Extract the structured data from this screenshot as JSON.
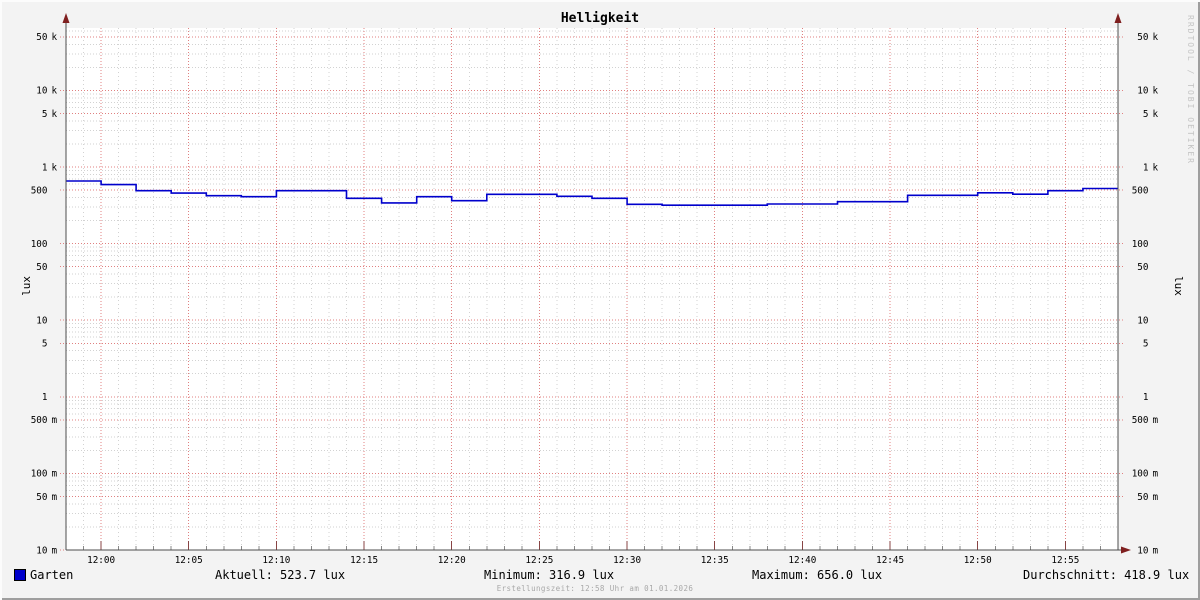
{
  "title": "Helligkeit",
  "watermark": "RRDTOOL / TOBI OETIKER",
  "axes": {
    "left_unit_label": "lux",
    "right_unit_label": "lux"
  },
  "legend": {
    "series_label": "Garten"
  },
  "stats": {
    "aktuell": "Aktuell: 523.7 lux",
    "minimum": "Minimum: 316.9 lux",
    "maximum": "Maximum: 656.0 lux",
    "durchschnitt": "Durchschnitt: 418.9 lux"
  },
  "footer": {
    "creation_text": "Erstellungszeit: 12:58 Uhr am 01.01.2026"
  },
  "chart_data": {
    "type": "line",
    "title": "Helligkeit",
    "xlabel": "",
    "ylabel": "lux",
    "y_scale": "logarithmic",
    "ylim": [
      0.01,
      65000
    ],
    "x_range": [
      "11:58",
      "12:58"
    ],
    "grid": true,
    "legend_position": "bottom-left",
    "colors": {
      "background": "#f3f3f3",
      "canvas": "#ffffff",
      "major_grid": "#e08080",
      "minor_grid": "#d2d2d2",
      "axis": "#4d4d4d",
      "arrow": "#7f1f1f"
    },
    "y_ticks": [
      {
        "num": "50",
        "unit": "k",
        "value": 50000
      },
      {
        "num": "10",
        "unit": "k",
        "value": 10000
      },
      {
        "num": "5",
        "unit": "k",
        "value": 5000
      },
      {
        "num": "1",
        "unit": "k",
        "value": 1000
      },
      {
        "num": "500",
        "unit": "",
        "value": 500
      },
      {
        "num": "100",
        "unit": "",
        "value": 100
      },
      {
        "num": "50",
        "unit": "",
        "value": 50
      },
      {
        "num": "10",
        "unit": "",
        "value": 10
      },
      {
        "num": "5",
        "unit": "",
        "value": 5
      },
      {
        "num": "1",
        "unit": "",
        "value": 1
      },
      {
        "num": "500",
        "unit": "m",
        "value": 0.5
      },
      {
        "num": "100",
        "unit": "m",
        "value": 0.1
      },
      {
        "num": "50",
        "unit": "m",
        "value": 0.05
      },
      {
        "num": "10",
        "unit": "m",
        "value": 0.01
      }
    ],
    "x_ticks": [
      "12:00",
      "12:05",
      "12:10",
      "12:15",
      "12:20",
      "12:25",
      "12:30",
      "12:35",
      "12:40",
      "12:45",
      "12:50",
      "12:55"
    ],
    "series": [
      {
        "name": "Garten",
        "color": "#0000cc",
        "line_style": "step",
        "steps": [
          {
            "t": "11:58",
            "v": 656.0
          },
          {
            "t": "12:00",
            "v": 590
          },
          {
            "t": "12:02",
            "v": 490
          },
          {
            "t": "12:04",
            "v": 457
          },
          {
            "t": "12:06",
            "v": 422
          },
          {
            "t": "12:08",
            "v": 409
          },
          {
            "t": "12:10",
            "v": 490
          },
          {
            "t": "12:14",
            "v": 390
          },
          {
            "t": "12:16",
            "v": 340
          },
          {
            "t": "12:18",
            "v": 410
          },
          {
            "t": "12:20",
            "v": 363
          },
          {
            "t": "12:22",
            "v": 440
          },
          {
            "t": "12:26",
            "v": 415
          },
          {
            "t": "12:28",
            "v": 390
          },
          {
            "t": "12:30",
            "v": 326
          },
          {
            "t": "12:32",
            "v": 316.9
          },
          {
            "t": "12:38",
            "v": 329
          },
          {
            "t": "12:42",
            "v": 352
          },
          {
            "t": "12:46",
            "v": 427
          },
          {
            "t": "12:50",
            "v": 461
          },
          {
            "t": "12:52",
            "v": 441
          },
          {
            "t": "12:54",
            "v": 491
          },
          {
            "t": "12:56",
            "v": 523.7
          }
        ]
      }
    ],
    "stats": {
      "current": 523.7,
      "min": 316.9,
      "max": 656.0,
      "avg": 418.9
    }
  }
}
